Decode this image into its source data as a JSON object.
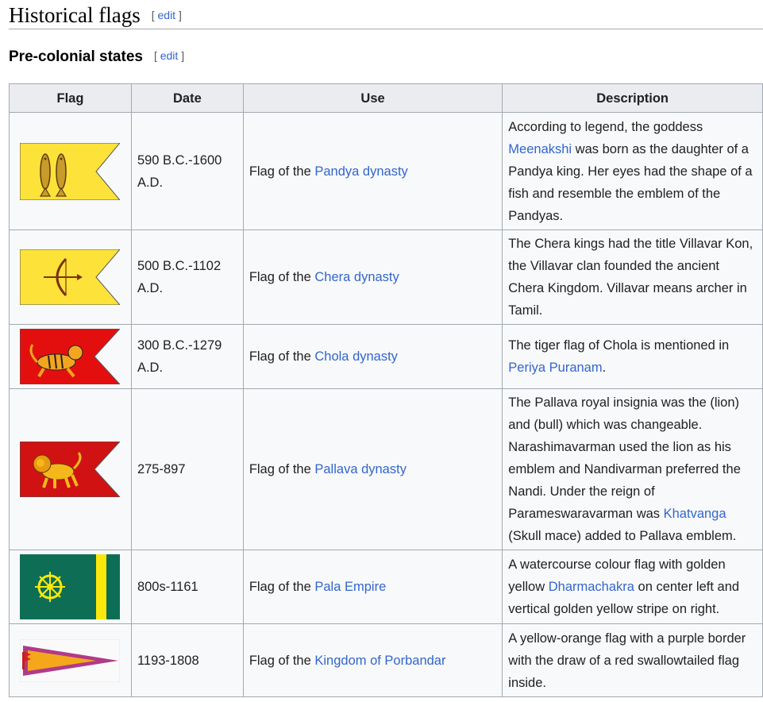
{
  "section": {
    "title": "Historical flags",
    "edit": "edit"
  },
  "subsection": {
    "title": "Pre-colonial states",
    "edit": "edit"
  },
  "table": {
    "headers": [
      "Flag",
      "Date",
      "Use",
      "Description"
    ],
    "rows": [
      {
        "flag_icon": "pandya-fish-flag-icon",
        "date": "590 B.C.-1600 A.D.",
        "use_prefix": "Flag of the ",
        "use_link": "Pandya dynasty",
        "desc": [
          {
            "t": "According to legend, the goddess "
          },
          {
            "t": "Meenakshi",
            "link": true
          },
          {
            "t": " was born as the daughter of a Pandya king. Her eyes had the shape of a fish and resemble the emblem of the Pandyas."
          }
        ]
      },
      {
        "flag_icon": "chera-bow-flag-icon",
        "date": "500 B.C.-1102 A.D.",
        "use_prefix": "Flag of the ",
        "use_link": "Chera dynasty",
        "desc": [
          {
            "t": "The Chera kings had the title Villavar Kon, the Villavar clan founded the ancient Chera Kingdom. Villavar means archer in Tamil."
          }
        ]
      },
      {
        "flag_icon": "chola-tiger-flag-icon",
        "date": "300 B.C.-1279 A.D.",
        "use_prefix": "Flag of the ",
        "use_link": "Chola dynasty",
        "desc": [
          {
            "t": "The tiger flag of Chola is mentioned in "
          },
          {
            "t": "Periya Puranam",
            "link": true
          },
          {
            "t": "."
          }
        ]
      },
      {
        "flag_icon": "pallava-lion-flag-icon",
        "date": "275-897",
        "use_prefix": "Flag of the ",
        "use_link": "Pallava dynasty",
        "desc": [
          {
            "t": "The Pallava royal insignia was the (lion) and (bull) which was changeable. Narashimavarman used the lion as his emblem and Nandivarman preferred the Nandi. Under the reign of Parameswaravarman was "
          },
          {
            "t": "Khatvanga",
            "link": true
          },
          {
            "t": " (Skull mace) added to Pallava emblem."
          }
        ]
      },
      {
        "flag_icon": "pala-dharmachakra-flag-icon",
        "date": "800s-1161",
        "use_prefix": "Flag of the ",
        "use_link": "Pala Empire",
        "desc": [
          {
            "t": "A watercourse colour flag with golden yellow "
          },
          {
            "t": "Dharmachakra",
            "link": true
          },
          {
            "t": " on center left and vertical golden yellow stripe on right."
          }
        ]
      },
      {
        "flag_icon": "porbandar-pennant-flag-icon",
        "date": "1193-1808",
        "use_prefix": "Flag of the ",
        "use_link": "Kingdom of Porbandar",
        "desc": [
          {
            "t": "A yellow-orange flag with a purple border with the draw of a red swallowtailed flag inside."
          }
        ]
      }
    ]
  },
  "colors": {
    "link": "#3366cc",
    "header_bg": "#eaecf0",
    "border": "#a2a9b1"
  }
}
